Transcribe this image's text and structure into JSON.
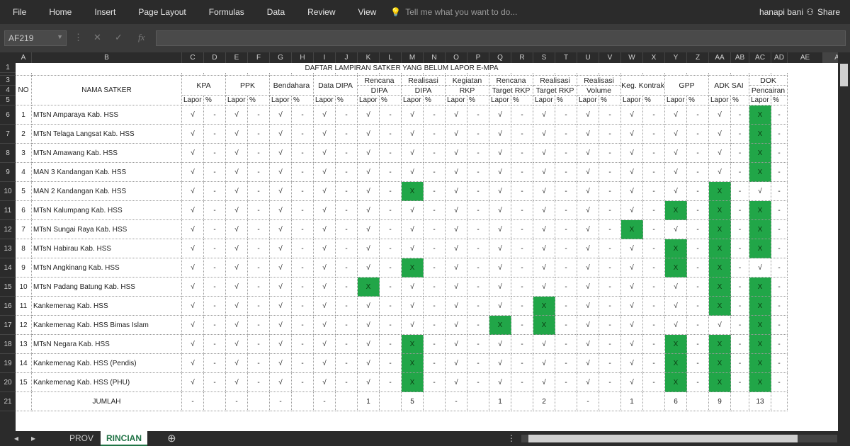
{
  "menu": [
    "File",
    "Home",
    "Insert",
    "Page Layout",
    "Formulas",
    "Data",
    "Review",
    "View"
  ],
  "tell_me": "Tell me what you want to do...",
  "user": "hanapi bani",
  "share": "Share",
  "name_box": "AF219",
  "fx": "fx",
  "columns": [
    "A",
    "B",
    "C",
    "D",
    "E",
    "F",
    "G",
    "H",
    "I",
    "J",
    "K",
    "L",
    "M",
    "N",
    "O",
    "P",
    "Q",
    "R",
    "S",
    "T",
    "U",
    "V",
    "W",
    "X",
    "Y",
    "Z",
    "AA",
    "AB",
    "AC",
    "AD",
    "AE",
    "AF"
  ],
  "rows": [
    "1",
    "2",
    "3",
    "4",
    "5",
    "6",
    "7",
    "8",
    "9",
    "10",
    "11",
    "12",
    "13",
    "14",
    "15",
    "16",
    "17",
    "18",
    "19",
    "20",
    "21"
  ],
  "sheet_title": "DAFTAR LAMPIRAN SATKER YANG BELUM LAPOR E-MPA",
  "header": {
    "no": "NO",
    "nama": "NAMA SATKER",
    "lapor": "Lapor",
    "pct": "%",
    "groups": [
      {
        "l1": "KPA",
        "l2": ""
      },
      {
        "l1": "PPK",
        "l2": ""
      },
      {
        "l1": "Bendahara",
        "l2": ""
      },
      {
        "l1": "Data DIPA",
        "l2": ""
      },
      {
        "l1": "Rencana",
        "l2": "DIPA"
      },
      {
        "l1": "Realisasi",
        "l2": "DIPA"
      },
      {
        "l1": "Kegiatan",
        "l2": "RKP"
      },
      {
        "l1": "Rencana",
        "l2": "Target RKP"
      },
      {
        "l1": "Realisasi",
        "l2": "Target RKP"
      },
      {
        "l1": "Realisasi",
        "l2": "Volume"
      },
      {
        "l1": "Keg. Kontrak",
        "l2": ""
      },
      {
        "l1": "GPP",
        "l2": ""
      },
      {
        "l1": "ADK SAI",
        "l2": ""
      },
      {
        "l1": "DOK",
        "l2": "Pencairan"
      }
    ]
  },
  "rows_data": [
    {
      "no": "1",
      "nama": "MTsN Amparaya Kab. HSS",
      "vals": [
        "√",
        "√",
        "√",
        "√",
        "√",
        "√",
        "√",
        "√",
        "√",
        "√",
        "√",
        "√",
        "√",
        "X"
      ]
    },
    {
      "no": "2",
      "nama": "MTsN Telaga Langsat Kab. HSS",
      "vals": [
        "√",
        "√",
        "√",
        "√",
        "√",
        "√",
        "√",
        "√",
        "√",
        "√",
        "√",
        "√",
        "√",
        "X"
      ]
    },
    {
      "no": "3",
      "nama": "MTsN Amawang Kab. HSS",
      "vals": [
        "√",
        "√",
        "√",
        "√",
        "√",
        "√",
        "√",
        "√",
        "√",
        "√",
        "√",
        "√",
        "√",
        "X"
      ]
    },
    {
      "no": "4",
      "nama": "MAN 3 Kandangan Kab. HSS",
      "vals": [
        "√",
        "√",
        "√",
        "√",
        "√",
        "√",
        "√",
        "√",
        "√",
        "√",
        "√",
        "√",
        "√",
        "X"
      ]
    },
    {
      "no": "5",
      "nama": "MAN 2 Kandangan Kab. HSS",
      "vals": [
        "√",
        "√",
        "√",
        "√",
        "√",
        "X",
        "√",
        "√",
        "√",
        "√",
        "√",
        "√",
        "X",
        "√"
      ]
    },
    {
      "no": "6",
      "nama": "MTsN Kalumpang Kab. HSS",
      "vals": [
        "√",
        "√",
        "√",
        "√",
        "√",
        "√",
        "√",
        "√",
        "√",
        "√",
        "√",
        "X",
        "X",
        "X"
      ]
    },
    {
      "no": "7",
      "nama": "MTsN Sungai Raya Kab. HSS",
      "vals": [
        "√",
        "√",
        "√",
        "√",
        "√",
        "√",
        "√",
        "√",
        "√",
        "√",
        "X",
        "√",
        "X",
        "X"
      ]
    },
    {
      "no": "8",
      "nama": "MTsN Habirau Kab. HSS",
      "vals": [
        "√",
        "√",
        "√",
        "√",
        "√",
        "√",
        "√",
        "√",
        "√",
        "√",
        "√",
        "X",
        "X",
        "X"
      ]
    },
    {
      "no": "9",
      "nama": "MTsN Angkinang Kab. HSS",
      "vals": [
        "√",
        "√",
        "√",
        "√",
        "√",
        "X",
        "√",
        "√",
        "√",
        "√",
        "√",
        "X",
        "X",
        "√"
      ]
    },
    {
      "no": "10",
      "nama": "MTsN Padang Batung Kab. HSS",
      "vals": [
        "√",
        "√",
        "√",
        "√",
        "X",
        "√",
        "√",
        "√",
        "√",
        "√",
        "√",
        "√",
        "X",
        "X"
      ]
    },
    {
      "no": "11",
      "nama": "Kankemenag Kab. HSS",
      "vals": [
        "√",
        "√",
        "√",
        "√",
        "√",
        "√",
        "√",
        "√",
        "X",
        "√",
        "√",
        "√",
        "X",
        "X"
      ]
    },
    {
      "no": "12",
      "nama": "Kankemenag Kab. HSS Bimas Islam",
      "vals": [
        "√",
        "√",
        "√",
        "√",
        "√",
        "√",
        "√",
        "X",
        "X",
        "√",
        "√",
        "√",
        "√",
        "X"
      ]
    },
    {
      "no": "13",
      "nama": "MTsN Negara Kab. HSS",
      "vals": [
        "√",
        "√",
        "√",
        "√",
        "√",
        "X",
        "√",
        "√",
        "√",
        "√",
        "√",
        "X",
        "X",
        "X"
      ]
    },
    {
      "no": "14",
      "nama": "Kankemenag Kab. HSS (Pendis)",
      "vals": [
        "√",
        "√",
        "√",
        "√",
        "√",
        "X",
        "√",
        "√",
        "√",
        "√",
        "√",
        "X",
        "X",
        "X"
      ]
    },
    {
      "no": "15",
      "nama": "Kankemenag Kab. HSS (PHU)",
      "vals": [
        "√",
        "√",
        "√",
        "√",
        "√",
        "X",
        "√",
        "√",
        "√",
        "√",
        "√",
        "X",
        "X",
        "X"
      ]
    }
  ],
  "dash": "-",
  "jumlah": {
    "label": "JUMLAH",
    "vals": [
      "-",
      "-",
      "-",
      "-",
      "1",
      "5",
      "-",
      "1",
      "2",
      "-",
      "1",
      "6",
      "9",
      "13"
    ]
  },
  "tabs": [
    "PROV",
    "RINCIAN"
  ],
  "active_tab": "RINCIAN",
  "accent": "#21a648"
}
